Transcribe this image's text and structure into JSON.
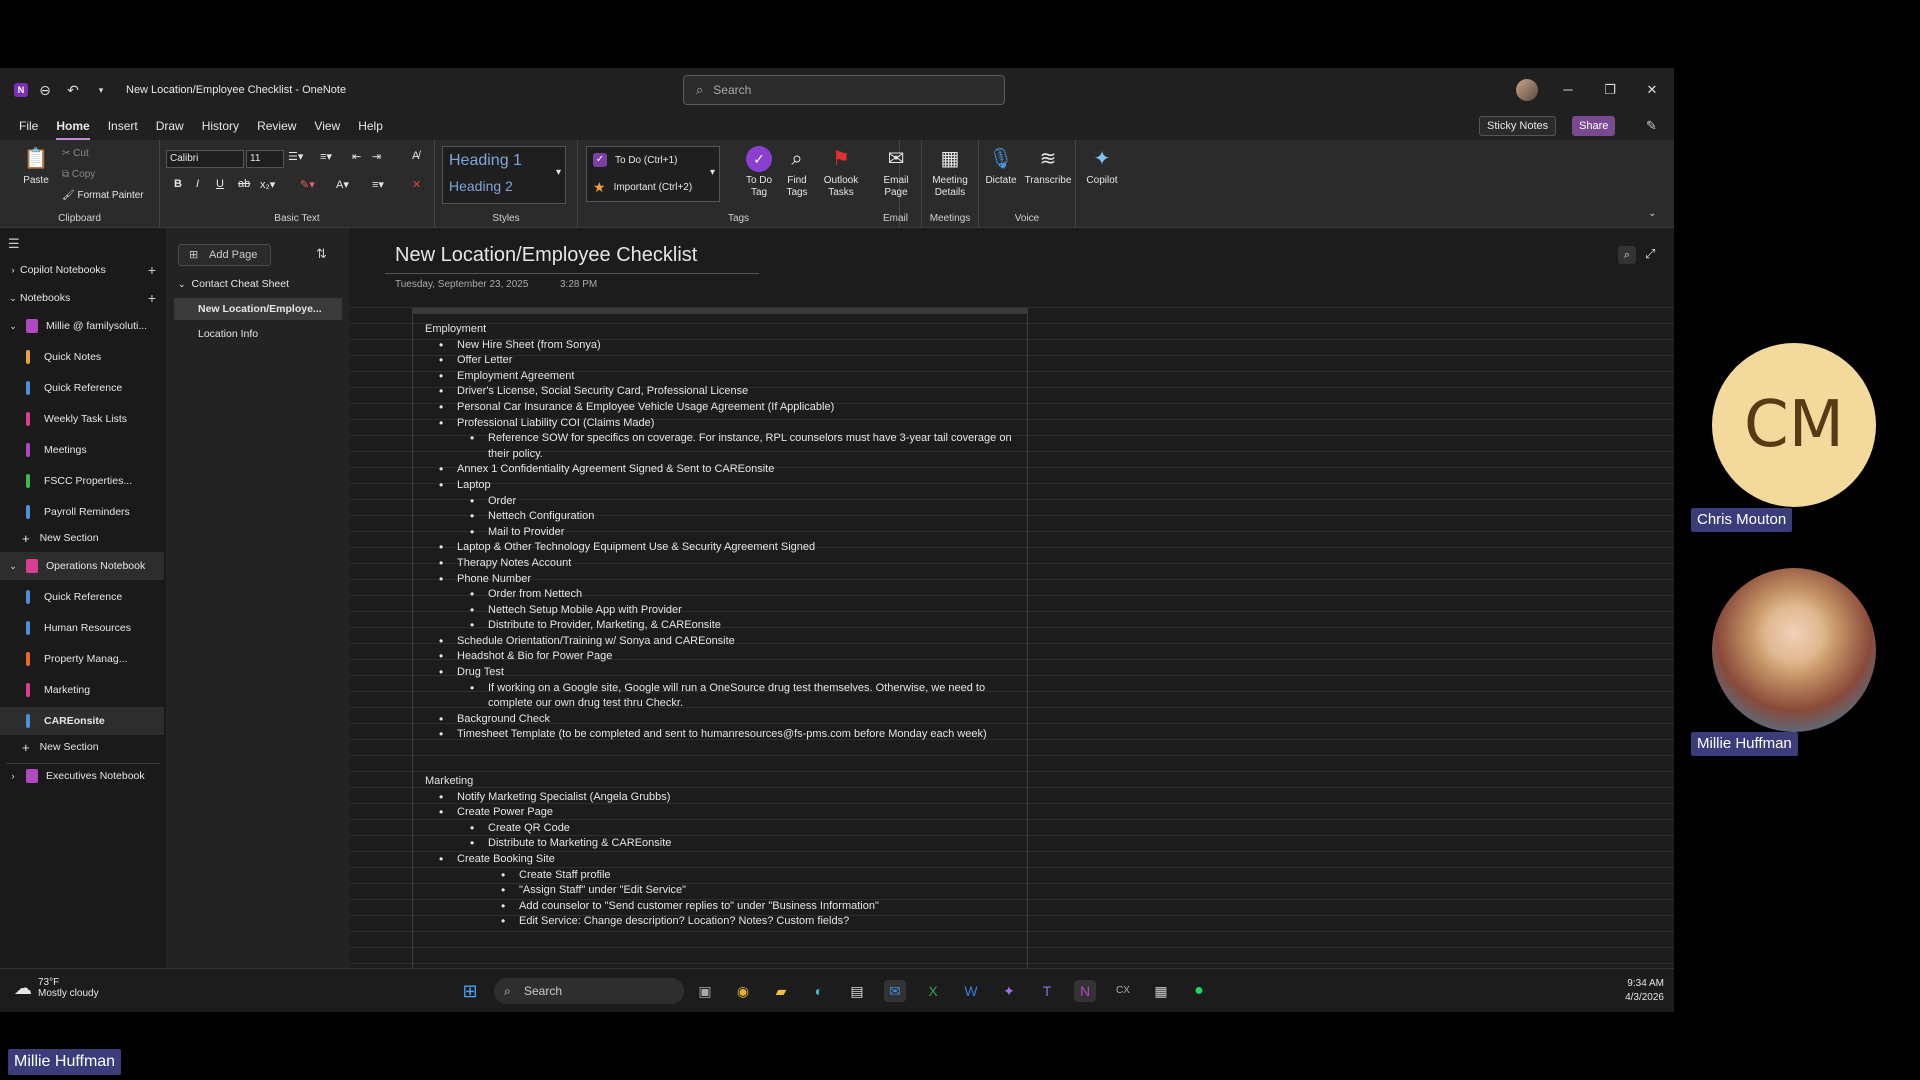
{
  "window": {
    "title": "New Location/Employee Checklist - OneNote",
    "search_placeholder": "Search"
  },
  "menu": [
    "File",
    "Home",
    "Insert",
    "Draw",
    "History",
    "Review",
    "View",
    "Help"
  ],
  "menu_right": {
    "sticky": "Sticky Notes",
    "share": "Share"
  },
  "ribbon": {
    "clipboard": {
      "paste": "Paste",
      "cut": "Cut",
      "copy": "Copy",
      "format_painter": "Format Painter",
      "label": "Clipboard"
    },
    "basic_text": {
      "font": "Calibri",
      "size": "11",
      "label": "Basic Text"
    },
    "styles": {
      "h1": "Heading 1",
      "h2": "Heading 2",
      "label": "Styles"
    },
    "tags": {
      "todo": "To Do (Ctrl+1)",
      "important": "Important (Ctrl+2)",
      "todo_tag": "To Do Tag",
      "find_tags": "Find Tags",
      "outlook_tasks": "Outlook Tasks",
      "label": "Tags"
    },
    "email": {
      "btn": "Email Page",
      "label": "Email"
    },
    "meetings": {
      "btn": "Meeting Details",
      "label": "Meetings"
    },
    "voice": {
      "dictate": "Dictate",
      "transcribe": "Transcribe",
      "label": "Voice"
    },
    "copilot": {
      "btn": "Copilot"
    }
  },
  "nav": {
    "copilot_notebooks": "Copilot Notebooks",
    "notebooks": "Notebooks",
    "notebook1": {
      "name": "Millie @ familysoluti...",
      "color": "#b146c2",
      "sections": [
        {
          "name": "Quick Notes",
          "color": "#e8a33d"
        },
        {
          "name": "Quick Reference",
          "color": "#4a8fd8"
        },
        {
          "name": "Weekly Task Lists",
          "color": "#d8408f"
        },
        {
          "name": "Meetings",
          "color": "#b146c2"
        },
        {
          "name": "FSCC Properties...",
          "color": "#3db852"
        },
        {
          "name": "Payroll Reminders",
          "color": "#4a8fd8"
        }
      ]
    },
    "new_section": "New Section",
    "notebook2": {
      "name": "Operations Notebook",
      "color": "#d8408f",
      "sections": [
        {
          "name": "Quick Reference",
          "color": "#4a8fd8"
        },
        {
          "name": "Human Resources",
          "color": "#4a8fd8"
        },
        {
          "name": "Property Manag...",
          "color": "#e86a2d"
        },
        {
          "name": "Marketing",
          "color": "#d8408f"
        },
        {
          "name": "CAREonsite",
          "color": "#4a8fd8"
        }
      ]
    },
    "notebook3": {
      "name": "Executives Notebook",
      "color": "#b146c2"
    }
  },
  "pages": {
    "add_page": "Add Page",
    "group": "Contact Cheat Sheet",
    "items": [
      "New Location/Employe...",
      "Location Info"
    ]
  },
  "page": {
    "title": "New Location/Employee Checklist",
    "date": "Tuesday, September 23, 2025",
    "time": "3:28 PM",
    "employment_header": "Employment",
    "employment": [
      {
        "lvl": 1,
        "text": "New Hire Sheet (from Sonya)"
      },
      {
        "lvl": 1,
        "text": "Offer Letter"
      },
      {
        "lvl": 1,
        "text": "Employment Agreement"
      },
      {
        "lvl": 1,
        "text": "Driver's License, Social Security Card, Professional License"
      },
      {
        "lvl": 1,
        "text": "Personal Car Insurance & Employee Vehicle Usage Agreement (If Applicable)"
      },
      {
        "lvl": 1,
        "text": "Professional Liability COI (Claims Made)"
      },
      {
        "lvl": 2,
        "text": "Reference SOW for specifics on coverage. For instance, RPL counselors must have 3-year tail coverage on their policy."
      },
      {
        "lvl": 1,
        "text": "Annex 1 Confidentiality Agreement Signed & Sent to CAREonsite"
      },
      {
        "lvl": 1,
        "text": "Laptop"
      },
      {
        "lvl": 2,
        "text": "Order"
      },
      {
        "lvl": 2,
        "text": "Nettech Configuration"
      },
      {
        "lvl": 2,
        "text": "Mail to Provider"
      },
      {
        "lvl": 1,
        "text": "Laptop & Other Technology Equipment Use & Security Agreement Signed"
      },
      {
        "lvl": 1,
        "text": "Therapy Notes Account"
      },
      {
        "lvl": 1,
        "text": "Phone Number"
      },
      {
        "lvl": 2,
        "text": "Order from Nettech"
      },
      {
        "lvl": 2,
        "text": "Nettech Setup Mobile App with Provider"
      },
      {
        "lvl": 2,
        "text": "Distribute to Provider, Marketing, & CAREonsite"
      },
      {
        "lvl": 1,
        "text": "Schedule Orientation/Training w/ Sonya and CAREonsite"
      },
      {
        "lvl": 1,
        "text": "Headshot & Bio for Power Page"
      },
      {
        "lvl": 1,
        "text": "Drug Test"
      },
      {
        "lvl": 2,
        "text": "If working on a Google site, Google will run a OneSource drug test themselves. Otherwise, we need to complete our own drug test thru Checkr."
      },
      {
        "lvl": 1,
        "text": "Background Check"
      },
      {
        "lvl": 1,
        "text": "Timesheet Template (to be completed and sent to humanresources@fs-pms.com before Monday each week)"
      }
    ],
    "marketing_header": "Marketing",
    "marketing": [
      {
        "lvl": 1,
        "text": "Notify Marketing Specialist (Angela Grubbs)"
      },
      {
        "lvl": 1,
        "text": "Create Power Page"
      },
      {
        "lvl": 2,
        "text": "Create QR Code"
      },
      {
        "lvl": 2,
        "text": "Distribute to Marketing & CAREonsite"
      },
      {
        "lvl": 1,
        "text": "Create Booking Site"
      },
      {
        "lvl": 3,
        "text": "Create Staff profile"
      },
      {
        "lvl": 3,
        "text": "\"Assign Staff\" under \"Edit Service\""
      },
      {
        "lvl": 3,
        "text": "Add counselor to \"Send customer replies to\" under \"Business Information\""
      },
      {
        "lvl": 3,
        "text": "Edit Service: Change description? Location? Notes? Custom fields?"
      }
    ]
  },
  "taskbar": {
    "temp": "73°F",
    "weather": "Mostly cloudy",
    "search": "Search",
    "time": "9:34 AM",
    "date": "4/3/2026"
  },
  "participants": {
    "cm_initials": "CM",
    "cm_name": "Chris Mouton",
    "mh_name": "Millie Huffman",
    "self_name": "Millie Huffman"
  }
}
